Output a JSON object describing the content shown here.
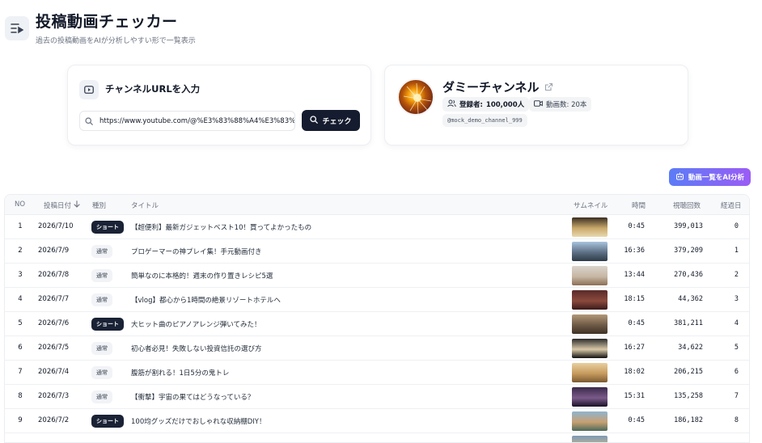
{
  "header": {
    "title": "投稿動画チェッカー",
    "subtitle": "過去の投稿動画をAIが分析しやすい形で一覧表示"
  },
  "url_card": {
    "heading": "チャンネルURLを入力",
    "input_value": "https://www.youtube.com/@%E3%83%88%A4%E3%83%88%A4%E3",
    "check_label": "チェック"
  },
  "channel": {
    "name": "ダミーチャンネル",
    "subscribers_label": "登録者:",
    "subscribers_value": "100,000人",
    "videos_text": "動画数: 20本",
    "handle": "@mock_demo_channel_999"
  },
  "ai_button_label": "動画一覧をAI分析",
  "table": {
    "headers": {
      "no": "NO",
      "date": "投稿日付",
      "type": "種別",
      "title": "タイトル",
      "thumb": "サムネイル",
      "time": "時間",
      "views": "視聴回数",
      "days": "経過日"
    },
    "rows": [
      {
        "no": "1",
        "date": "2026/7/10",
        "type": "ショート",
        "kind": "short",
        "title": "【超便利】最新ガジェットベスト10！買ってよかったもの",
        "thumb": [
          "#3a2e22",
          "#c9a86a",
          "#e8d9b0"
        ],
        "time": "0:45",
        "views": "399,013",
        "days": "0"
      },
      {
        "no": "2",
        "date": "2026/7/9",
        "type": "通常",
        "kind": "normal",
        "title": "プロゲーマーの神プレイ集！手元動画付き",
        "thumb": [
          "#a8c4de",
          "#5d6f84",
          "#2e3b48"
        ],
        "time": "16:36",
        "views": "379,209",
        "days": "1"
      },
      {
        "no": "3",
        "date": "2026/7/8",
        "type": "通常",
        "kind": "normal",
        "title": "簡単なのに本格的！週末の作り置きレシピ5選",
        "thumb": [
          "#d9d4cc",
          "#c7b6a3",
          "#8c6f55"
        ],
        "time": "13:44",
        "views": "270,436",
        "days": "2"
      },
      {
        "no": "4",
        "date": "2026/7/7",
        "type": "通常",
        "kind": "normal",
        "title": "【vlog】都心から1時間の絶景リゾートホテルへ",
        "thumb": [
          "#5a2a2a",
          "#8b4a3c",
          "#3a1a1a"
        ],
        "time": "18:15",
        "views": "44,362",
        "days": "3"
      },
      {
        "no": "5",
        "date": "2026/7/6",
        "type": "ショート",
        "kind": "short",
        "title": "大ヒット曲のピアノアレンジ弾いてみた！",
        "thumb": [
          "#b39878",
          "#6e5a46",
          "#3e3024"
        ],
        "time": "0:45",
        "views": "381,211",
        "days": "4"
      },
      {
        "no": "6",
        "date": "2026/7/5",
        "type": "通常",
        "kind": "normal",
        "title": "初心者必見！失敗しない投資信託の選び方",
        "thumb": [
          "#2b2b2b",
          "#d9c9a8",
          "#111111"
        ],
        "time": "16:27",
        "views": "34,622",
        "days": "5"
      },
      {
        "no": "7",
        "date": "2026/7/4",
        "type": "通常",
        "kind": "normal",
        "title": "腹筋が割れる！1日5分の鬼トレ",
        "thumb": [
          "#e8cfa0",
          "#c69a5c",
          "#7a5a32"
        ],
        "time": "18:02",
        "views": "206,215",
        "days": "6"
      },
      {
        "no": "8",
        "date": "2026/7/3",
        "type": "通常",
        "kind": "normal",
        "title": "【衝撃】宇宙の果てはどうなっている？",
        "thumb": [
          "#3a2a4a",
          "#7a5a8a",
          "#1a1226"
        ],
        "time": "15:31",
        "views": "135,258",
        "days": "7"
      },
      {
        "no": "9",
        "date": "2026/7/2",
        "type": "ショート",
        "kind": "short",
        "title": "100均グッズだけでおしゃれな収納棚DIY！",
        "thumb": [
          "#8fb4d0",
          "#c8a070",
          "#4a6a5a"
        ],
        "time": "0:45",
        "views": "186,182",
        "days": "8"
      },
      {
        "no": "",
        "date": "",
        "type": "",
        "kind": "normal",
        "title": "",
        "thumb": [
          "#7a9ab8",
          "#c9b48a",
          "#3a4a5a"
        ],
        "time": "",
        "views": "",
        "days": ""
      }
    ]
  },
  "colors": {
    "primary_dark": "#151c2f",
    "ai_gradient_start": "#5b7cf6",
    "ai_gradient_end": "#9b5cf5"
  },
  "icons": {
    "app": "list-play-icon",
    "url": "video-icon",
    "search": "search-icon",
    "external": "external-link-icon",
    "users": "users-icon",
    "camera": "camera-icon",
    "robot": "robot-icon",
    "sort": "arrow-down-icon"
  }
}
